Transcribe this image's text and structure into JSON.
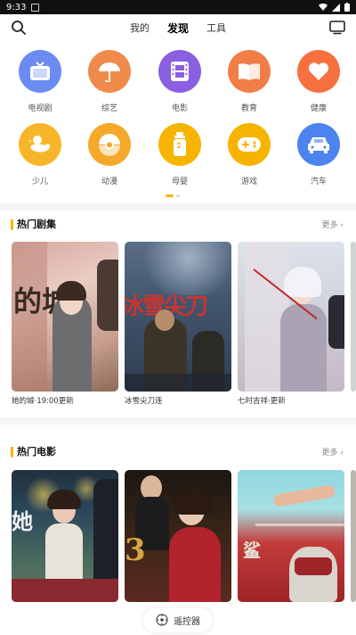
{
  "status": {
    "time": "9:33"
  },
  "nav": {
    "tabs": [
      "我的",
      "发现",
      "工具"
    ],
    "active_index": 1
  },
  "categories": [
    {
      "label": "电视剧",
      "icon": "tv-icon",
      "color": "#6a8cf2"
    },
    {
      "label": "综艺",
      "icon": "umbrella-icon",
      "color": "#f08a4a"
    },
    {
      "label": "电影",
      "icon": "film-icon",
      "color": "#8a5fe0"
    },
    {
      "label": "教育",
      "icon": "book-icon",
      "color": "#f07e46"
    },
    {
      "label": "健康",
      "icon": "heart-icon",
      "color": "#f7703f"
    },
    {
      "label": "少儿",
      "icon": "duck-icon",
      "color": "#f7b62a"
    },
    {
      "label": "动漫",
      "icon": "pokeball-icon",
      "color": "#f5a82a"
    },
    {
      "label": "母婴",
      "icon": "bottle-icon",
      "color": "#f6b400"
    },
    {
      "label": "游戏",
      "icon": "gamepad-icon",
      "color": "#f6b400"
    },
    {
      "label": "汽车",
      "icon": "car-icon",
      "color": "#4c83ef"
    }
  ],
  "sections": [
    {
      "title": "热门剧集",
      "more": "更多 ›",
      "items": [
        {
          "caption": "她的城·19:00更新",
          "poster_text": "的城"
        },
        {
          "caption": "冰雪尖刀连",
          "poster_text": "冰雪尖刀"
        },
        {
          "caption": "七时吉祥·更新",
          "poster_text": ""
        }
      ]
    },
    {
      "title": "热门电影",
      "more": "更多 ›",
      "items": [
        {
          "caption": "",
          "poster_text": "她"
        },
        {
          "caption": "",
          "poster_text": ""
        },
        {
          "caption": "",
          "poster_text": ""
        }
      ]
    }
  ],
  "bottom": {
    "label": "遥控器"
  }
}
